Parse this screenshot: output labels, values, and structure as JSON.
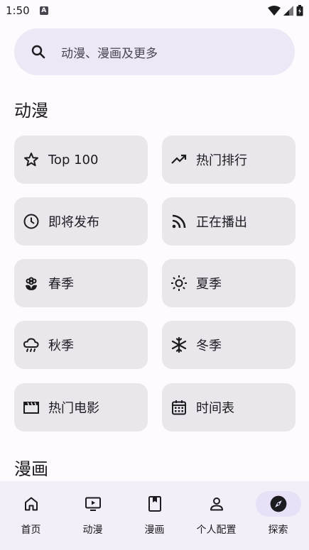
{
  "status_bar": {
    "time": "1:50",
    "notification_icon": "A"
  },
  "search": {
    "placeholder": "动漫、漫画及更多"
  },
  "anime_section": {
    "title": "动漫",
    "buttons": [
      {
        "label": "Top 100",
        "icon": "star-icon"
      },
      {
        "label": "热门排行",
        "icon": "trending-up-icon"
      },
      {
        "label": "即将发布",
        "icon": "clock-icon"
      },
      {
        "label": "正在播出",
        "icon": "rss-icon"
      },
      {
        "label": "春季",
        "icon": "flower-icon"
      },
      {
        "label": "夏季",
        "icon": "sun-icon"
      },
      {
        "label": "秋季",
        "icon": "rain-cloud-icon"
      },
      {
        "label": "冬季",
        "icon": "snowflake-icon"
      },
      {
        "label": "热门电影",
        "icon": "movie-icon"
      },
      {
        "label": "时间表",
        "icon": "calendar-icon"
      }
    ]
  },
  "manga_section": {
    "title": "漫画"
  },
  "bottom_nav": {
    "items": [
      {
        "label": "首页",
        "icon": "home-icon"
      },
      {
        "label": "动漫",
        "icon": "tv-icon"
      },
      {
        "label": "漫画",
        "icon": "book-icon"
      },
      {
        "label": "个人配置",
        "icon": "person-icon"
      },
      {
        "label": "探索",
        "icon": "compass-icon",
        "active": true
      }
    ]
  },
  "colors": {
    "background": "#fefbff",
    "search_bg": "#ede7f6",
    "button_bg": "#e9e6ec",
    "nav_bg": "#f3eef7",
    "active_pill": "#e7e0f6"
  }
}
